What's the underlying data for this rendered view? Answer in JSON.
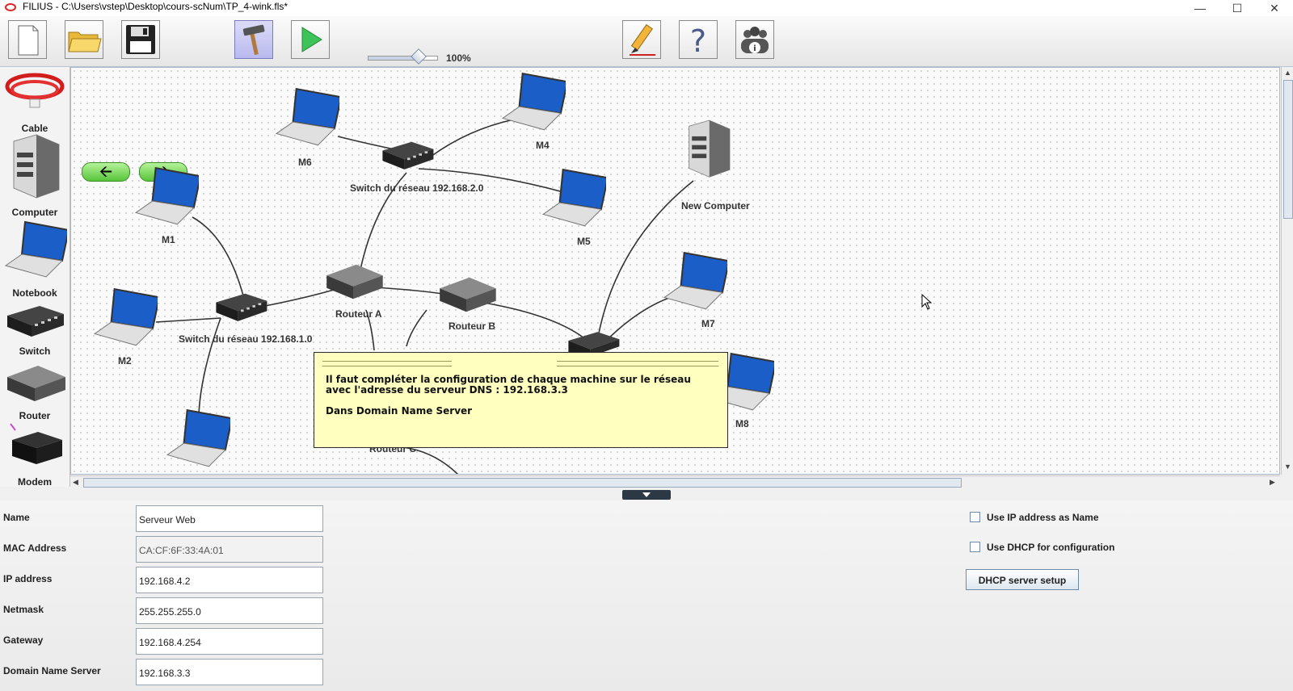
{
  "window": {
    "title": "FILIUS - C:\\Users\\vstep\\Desktop\\cours-scNum\\TP_4-wink.fls*"
  },
  "toolbar": {
    "zoom_value": 0.72,
    "zoom_label": "100%"
  },
  "palette": [
    {
      "label": "Cable",
      "icon": "cable-icon"
    },
    {
      "label": "Computer",
      "icon": "computer-icon"
    },
    {
      "label": "Notebook",
      "icon": "notebook-icon"
    },
    {
      "label": "Switch",
      "icon": "switch-icon"
    },
    {
      "label": "Router",
      "icon": "router-icon"
    },
    {
      "label": "Modem",
      "icon": "modem-icon"
    }
  ],
  "network": {
    "m6": "M6",
    "m4": "M4",
    "m1": "M1",
    "m5": "M5",
    "m2": "M2",
    "m7": "M7",
    "m8": "M8",
    "switch2": "Switch du réseau 192.168.2.0",
    "switch1": "Switch du réseau 192.168.1.0",
    "new_computer": "New Computer",
    "router_a": "Routeur A",
    "router_b": "Routeur B",
    "router_c": "Routeur C"
  },
  "note": {
    "line1": "Il faut compléter la configuration de chaque machine sur le réseau",
    "line2": "avec l'adresse du serveur DNS : 192.168.3.3",
    "line3": "Dans Domain Name Server"
  },
  "properties": {
    "name_label": "Name",
    "name_value": "Serveur Web",
    "mac_label": "MAC Address",
    "mac_value": "CA:CF:6F:33:4A:01",
    "ip_label": "IP address",
    "ip_value": "192.168.4.2",
    "netmask_label": "Netmask",
    "netmask_value": "255.255.255.0",
    "gateway_label": "Gateway",
    "gateway_value": "192.168.4.254",
    "dns_label": "Domain Name Server",
    "dns_value": "192.168.3.3",
    "use_ip_as_name": "Use IP address as Name",
    "use_dhcp": "Use DHCP for configuration",
    "dhcp_setup": "DHCP server setup"
  }
}
